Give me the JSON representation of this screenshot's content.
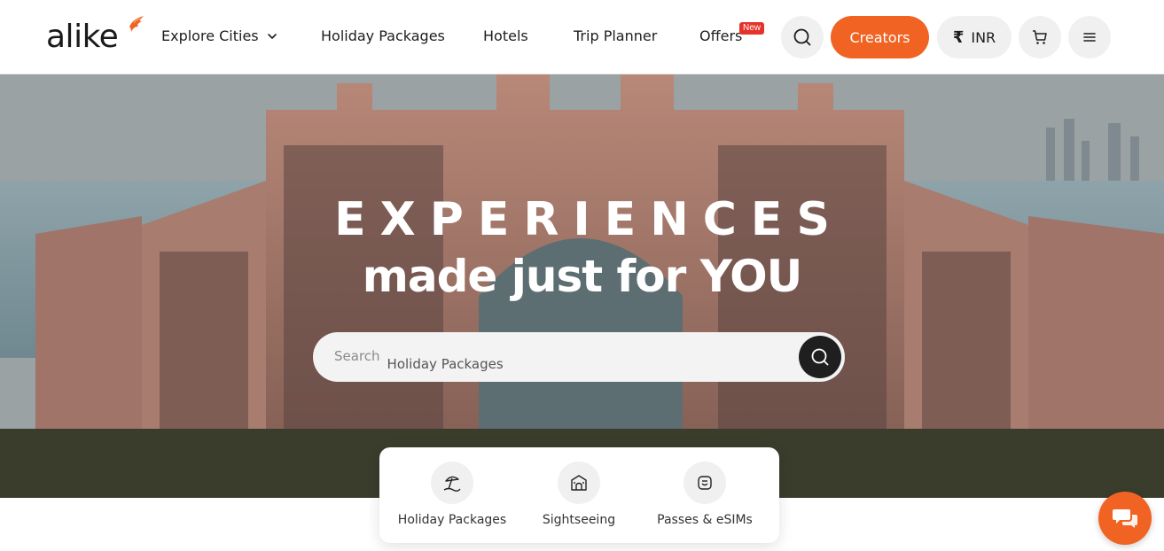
{
  "brand": {
    "name": "alike",
    "accent_color": "#f06323",
    "logo_icon": "phoenix-bird-icon"
  },
  "nav": {
    "explore_cities": "Explore Cities",
    "holiday_packages": "Holiday Packages",
    "hotels": "Hotels",
    "trip_planner": "Trip Planner",
    "offers": "Offers",
    "offers_badge": "New"
  },
  "header_actions": {
    "search_icon": "search-icon",
    "creators_label": "Creators",
    "currency_symbol": "₹",
    "currency_label": "INR",
    "cart_icon": "cart-icon",
    "menu_icon": "hamburger-menu-icon"
  },
  "hero": {
    "title": "EXPERIENCES",
    "subtitle": "made just for YOU",
    "search_label": "Search",
    "search_value": "Holiday Packages"
  },
  "categories": [
    {
      "label": "Holiday Packages",
      "icon": "beach-umbrella-icon"
    },
    {
      "label": "Sightseeing",
      "icon": "landmark-icon"
    },
    {
      "label": "Passes & eSIMs",
      "icon": "ticket-pass-icon"
    }
  ],
  "chat": {
    "icon": "chat-bubbles-icon"
  }
}
